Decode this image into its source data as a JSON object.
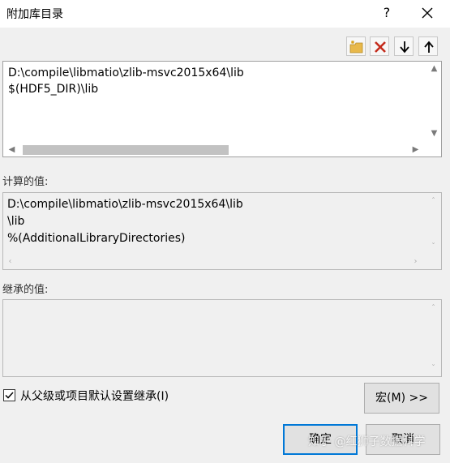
{
  "window": {
    "title": "附加库目录",
    "help_label": "?"
  },
  "list": {
    "lines": [
      "D:\\compile\\libmatio\\zlib-msvc2015x64\\lib",
      "$(HDF5_DIR)\\lib"
    ]
  },
  "computed": {
    "label": "计算的值:",
    "lines": [
      "D:\\compile\\libmatio\\zlib-msvc2015x64\\lib",
      "\\lib",
      "%(AdditionalLibraryDirectories)"
    ]
  },
  "inherited": {
    "label": "继承的值:"
  },
  "inherit_checkbox": {
    "label": "从父级或项目默认设置继承(I)",
    "checked": true
  },
  "buttons": {
    "macro": "宏(M) >>",
    "ok": "确定",
    "cancel": "取消"
  },
  "watermark": "知乎 @红狮子数据科学",
  "icons": {
    "new_line": "new-folder-icon",
    "delete": "delete-x-icon",
    "move_down": "arrow-down-icon",
    "move_up": "arrow-up-icon"
  },
  "colors": {
    "delete_red": "#c42b1c",
    "folder_yellow": "#e8b84a",
    "focus_blue": "#0078d7"
  }
}
